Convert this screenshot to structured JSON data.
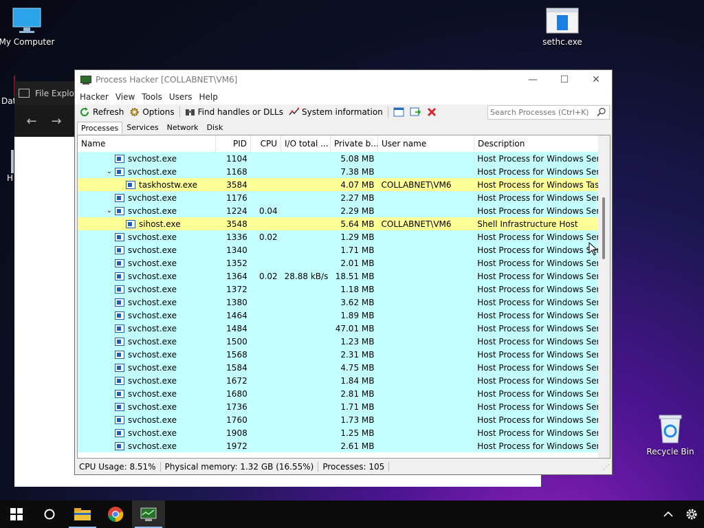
{
  "desktop": {
    "icons": {
      "my_computer": "My Computer",
      "sethc": "sethc.exe",
      "recycle_bin": "Recycle Bin",
      "dat_partial": "Dat",
      "h_partial": "H"
    }
  },
  "file_explorer": {
    "title": "File Explore"
  },
  "window": {
    "title": "Process Hacker [COLLABNET\\VM6]",
    "controls": {
      "minimize": "—",
      "maximize": "☐",
      "close": "✕"
    }
  },
  "menu": [
    "Hacker",
    "View",
    "Tools",
    "Users",
    "Help"
  ],
  "toolbar": {
    "refresh": "Refresh",
    "options": "Options",
    "find_handles": "Find handles or DLLs",
    "system_info": "System information",
    "search_placeholder": "Search Processes (Ctrl+K)"
  },
  "tabs": [
    "Processes",
    "Services",
    "Network",
    "Disk"
  ],
  "columns": [
    "Name",
    "PID",
    "CPU",
    "I/O total ...",
    "Private b...",
    "User name",
    "Description"
  ],
  "rows": [
    {
      "name": "svchost.exe",
      "pid": "1104",
      "cpu": "",
      "io": "",
      "priv": "5.08 MB",
      "user": "",
      "desc": "Host Process for Windows Ser..."
    },
    {
      "name": "svchost.exe",
      "pid": "1168",
      "cpu": "",
      "io": "",
      "priv": "7.38 MB",
      "user": "",
      "desc": "Host Process for Windows Ser..."
    },
    {
      "name": "taskhostw.exe",
      "pid": "3584",
      "cpu": "",
      "io": "",
      "priv": "4.07 MB",
      "user": "COLLABNET\\VM6",
      "desc": "Host Process for Windows Tasks"
    },
    {
      "name": "svchost.exe",
      "pid": "1176",
      "cpu": "",
      "io": "",
      "priv": "2.27 MB",
      "user": "",
      "desc": "Host Process for Windows Ser..."
    },
    {
      "name": "svchost.exe",
      "pid": "1224",
      "cpu": "0.04",
      "io": "",
      "priv": "2.29 MB",
      "user": "",
      "desc": "Host Process for Windows Ser..."
    },
    {
      "name": "sihost.exe",
      "pid": "3548",
      "cpu": "",
      "io": "",
      "priv": "5.64 MB",
      "user": "COLLABNET\\VM6",
      "desc": "Shell Infrastructure Host"
    },
    {
      "name": "svchost.exe",
      "pid": "1336",
      "cpu": "0.02",
      "io": "",
      "priv": "1.29 MB",
      "user": "",
      "desc": "Host Process for Windows Ser..."
    },
    {
      "name": "svchost.exe",
      "pid": "1340",
      "cpu": "",
      "io": "",
      "priv": "1.71 MB",
      "user": "",
      "desc": "Host Process for Windows Ser..."
    },
    {
      "name": "svchost.exe",
      "pid": "1352",
      "cpu": "",
      "io": "",
      "priv": "2.01 MB",
      "user": "",
      "desc": "Host Process for Windows Ser..."
    },
    {
      "name": "svchost.exe",
      "pid": "1364",
      "cpu": "0.02",
      "io": "28.88 kB/s",
      "priv": "18.51 MB",
      "user": "",
      "desc": "Host Process for Windows Ser..."
    },
    {
      "name": "svchost.exe",
      "pid": "1372",
      "cpu": "",
      "io": "",
      "priv": "1.18 MB",
      "user": "",
      "desc": "Host Process for Windows Ser..."
    },
    {
      "name": "svchost.exe",
      "pid": "1380",
      "cpu": "",
      "io": "",
      "priv": "3.62 MB",
      "user": "",
      "desc": "Host Process for Windows Ser..."
    },
    {
      "name": "svchost.exe",
      "pid": "1464",
      "cpu": "",
      "io": "",
      "priv": "1.89 MB",
      "user": "",
      "desc": "Host Process for Windows Ser..."
    },
    {
      "name": "svchost.exe",
      "pid": "1484",
      "cpu": "",
      "io": "",
      "priv": "47.01 MB",
      "user": "",
      "desc": "Host Process for Windows Ser..."
    },
    {
      "name": "svchost.exe",
      "pid": "1500",
      "cpu": "",
      "io": "",
      "priv": "1.23 MB",
      "user": "",
      "desc": "Host Process for Windows Ser..."
    },
    {
      "name": "svchost.exe",
      "pid": "1568",
      "cpu": "",
      "io": "",
      "priv": "2.31 MB",
      "user": "",
      "desc": "Host Process for Windows Ser..."
    },
    {
      "name": "svchost.exe",
      "pid": "1584",
      "cpu": "",
      "io": "",
      "priv": "4.75 MB",
      "user": "",
      "desc": "Host Process for Windows Ser..."
    },
    {
      "name": "svchost.exe",
      "pid": "1672",
      "cpu": "",
      "io": "",
      "priv": "1.84 MB",
      "user": "",
      "desc": "Host Process for Windows Ser..."
    },
    {
      "name": "svchost.exe",
      "pid": "1680",
      "cpu": "",
      "io": "",
      "priv": "2.81 MB",
      "user": "",
      "desc": "Host Process for Windows Ser..."
    },
    {
      "name": "svchost.exe",
      "pid": "1736",
      "cpu": "",
      "io": "",
      "priv": "1.71 MB",
      "user": "",
      "desc": "Host Process for Windows Ser..."
    },
    {
      "name": "svchost.exe",
      "pid": "1760",
      "cpu": "",
      "io": "",
      "priv": "1.73 MB",
      "user": "",
      "desc": "Host Process for Windows Ser..."
    },
    {
      "name": "svchost.exe",
      "pid": "1908",
      "cpu": "",
      "io": "",
      "priv": "1.25 MB",
      "user": "",
      "desc": "Host Process for Windows Ser..."
    },
    {
      "name": "svchost.exe",
      "pid": "1972",
      "cpu": "",
      "io": "",
      "priv": "2.61 MB",
      "user": "",
      "desc": "Host Process for Windows Ser..."
    }
  ],
  "status": {
    "cpu": "CPU Usage: 8.51%",
    "memory": "Physical memory: 1.32 GB (16.55%)",
    "processes": "Processes: 105"
  },
  "colors": {
    "service_row": "#c4ffff",
    "user_row": "#ffff95",
    "accent": "#1a5fb4"
  }
}
